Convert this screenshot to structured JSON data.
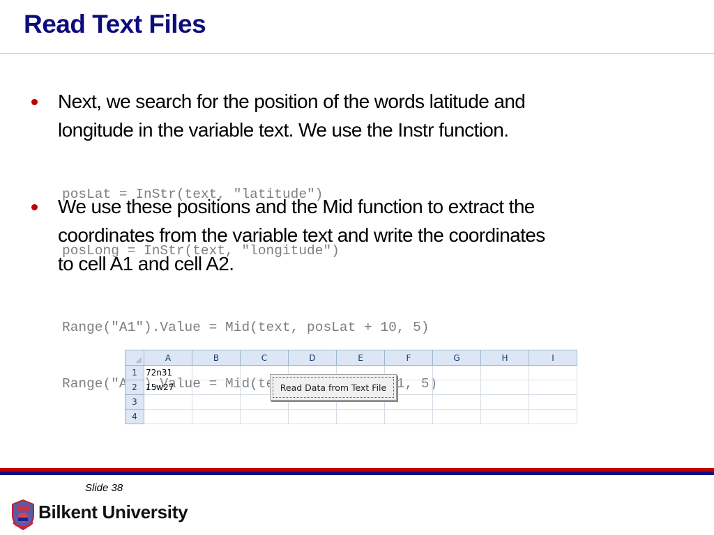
{
  "slide": {
    "title": "Read Text Files",
    "slide_number": "Slide 38",
    "footer_brand": "Bilkent University",
    "accent_colors": {
      "title": "#0c0c7c",
      "bullet": "#c00000",
      "band_top": "#c00000",
      "band_bottom": "#101080"
    }
  },
  "bullets": [
    {
      "lines": [
        "Next, we search for the position of the words latitude and",
        "longitude in the variable text. We use the Instr function."
      ],
      "code": [
        "posLat = InStr(text, \"latitude\")",
        "posLong = InStr(text, \"longitude\")"
      ]
    },
    {
      "lines": [
        "We use these positions and the Mid function to extract the",
        "coordinates from the variable text and write the coordinates",
        "to cell A1 and cell A2."
      ],
      "code": [
        "Range(\"A1\").Value = Mid(text, posLat + 10, 5)",
        "Range(\"A2\").Value = Mid(text, posLong + 11, 5)"
      ]
    }
  ],
  "spreadsheet": {
    "columns": [
      "A",
      "B",
      "C",
      "D",
      "E",
      "F",
      "G",
      "H",
      "I"
    ],
    "rows": [
      {
        "label": "1",
        "cells": [
          "72n31",
          "",
          "",
          "",
          "",
          "",
          "",
          "",
          ""
        ]
      },
      {
        "label": "2",
        "cells": [
          "15w27",
          "",
          "",
          "",
          "",
          "",
          "",
          "",
          ""
        ]
      },
      {
        "label": "3",
        "cells": [
          "",
          "",
          "",
          "",
          "",
          "",
          "",
          "",
          ""
        ]
      },
      {
        "label": "4",
        "cells": [
          "",
          "",
          "",
          "",
          "",
          "",
          "",
          "",
          ""
        ]
      }
    ],
    "button_label": "Read Data from Text File"
  }
}
